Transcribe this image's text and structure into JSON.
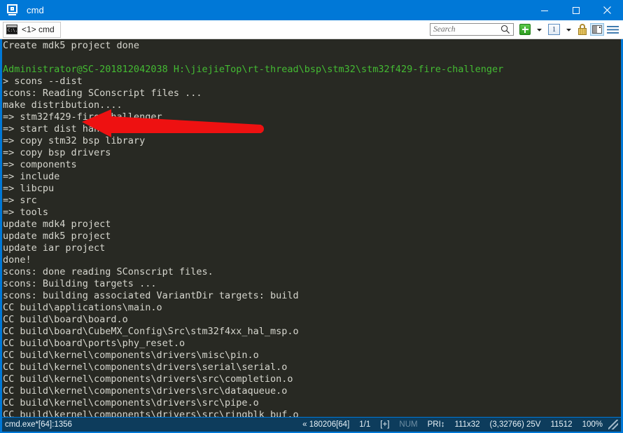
{
  "window": {
    "title": "cmd",
    "icon": "console-window-icon",
    "controls": {
      "minimize": "minimize-icon",
      "maximize": "maximize-icon",
      "close": "close-icon"
    }
  },
  "tabbar": {
    "tabs": [
      {
        "label": "<1> cmd",
        "icon": "cmd-console-icon",
        "icon_text": "C:\\."
      }
    ],
    "search": {
      "placeholder": "Search",
      "value": "",
      "icon": "search-icon"
    },
    "buttons": [
      {
        "name": "new-console-button",
        "icon": "green-plus-icon"
      },
      {
        "name": "new-console-dropdown",
        "icon": "chevron-down-icon"
      },
      {
        "name": "active-console-count",
        "icon": "numbered-box-icon",
        "label": "1"
      },
      {
        "name": "console-list-dropdown",
        "icon": "chevron-down-icon"
      },
      {
        "name": "admin-lock-button",
        "icon": "lock-icon"
      },
      {
        "name": "split-pane-button",
        "icon": "split-pane-icon"
      },
      {
        "name": "main-menu-button",
        "icon": "hamburger-menu-icon"
      }
    ]
  },
  "terminal": {
    "lines": [
      {
        "text": "Create mdk5 project done",
        "color": "white"
      },
      {
        "text": "",
        "color": "white"
      },
      {
        "text": "Administrator@SC-201812042038 H:\\jiejieTop\\rt-thread\\bsp\\stm32\\stm32f429-fire-challenger",
        "color": "green"
      },
      {
        "text": "> scons --dist",
        "color": "white"
      },
      {
        "text": "scons: Reading SConscript files ...",
        "color": "white"
      },
      {
        "text": "make distribution....",
        "color": "white"
      },
      {
        "text": "=> stm32f429-fire-challenger",
        "color": "white"
      },
      {
        "text": "=> start dist handle",
        "color": "white"
      },
      {
        "text": "=> copy stm32 bsp library",
        "color": "white"
      },
      {
        "text": "=> copy bsp drivers",
        "color": "white"
      },
      {
        "text": "=> components",
        "color": "white"
      },
      {
        "text": "=> include",
        "color": "white"
      },
      {
        "text": "=> libcpu",
        "color": "white"
      },
      {
        "text": "=> src",
        "color": "white"
      },
      {
        "text": "=> tools",
        "color": "white"
      },
      {
        "text": "update mdk4 project",
        "color": "white"
      },
      {
        "text": "update mdk5 project",
        "color": "white"
      },
      {
        "text": "update iar project",
        "color": "white"
      },
      {
        "text": "done!",
        "color": "white"
      },
      {
        "text": "scons: done reading SConscript files.",
        "color": "white"
      },
      {
        "text": "scons: Building targets ...",
        "color": "white"
      },
      {
        "text": "scons: building associated VariantDir targets: build",
        "color": "white"
      },
      {
        "text": "CC build\\applications\\main.o",
        "color": "white"
      },
      {
        "text": "CC build\\board\\board.o",
        "color": "white"
      },
      {
        "text": "CC build\\board\\CubeMX_Config\\Src\\stm32f4xx_hal_msp.o",
        "color": "white"
      },
      {
        "text": "CC build\\board\\ports\\phy_reset.o",
        "color": "white"
      },
      {
        "text": "CC build\\kernel\\components\\drivers\\misc\\pin.o",
        "color": "white"
      },
      {
        "text": "CC build\\kernel\\components\\drivers\\serial\\serial.o",
        "color": "white"
      },
      {
        "text": "CC build\\kernel\\components\\drivers\\src\\completion.o",
        "color": "white"
      },
      {
        "text": "CC build\\kernel\\components\\drivers\\src\\dataqueue.o",
        "color": "white"
      },
      {
        "text": "CC build\\kernel\\components\\drivers\\src\\pipe.o",
        "color": "white"
      },
      {
        "text": "CC build\\kernel\\components\\drivers\\src\\ringblk_buf.o",
        "color": "white"
      }
    ]
  },
  "annotation": {
    "arrow": {
      "name": "red-arrow-annotation",
      "color": "#ee1111",
      "direction": "left"
    }
  },
  "statusbar": {
    "process": "cmd.exe*[64]:1356",
    "build": "« 180206[64]",
    "pages": "1/1",
    "plus": "[+]",
    "num": "NUM",
    "pri": "PRI↕",
    "size": "111x32",
    "buffer": "(3,32766) 25V",
    "handles": "11512",
    "zoom": "100%"
  },
  "colors": {
    "titlebar": "#0078d7",
    "terminal_bg": "#282923",
    "terminal_fg": "#d6d6ce",
    "prompt_green": "#44bb33",
    "statusbar_bg": "#0d3c5c",
    "arrow_red": "#ee1111"
  }
}
